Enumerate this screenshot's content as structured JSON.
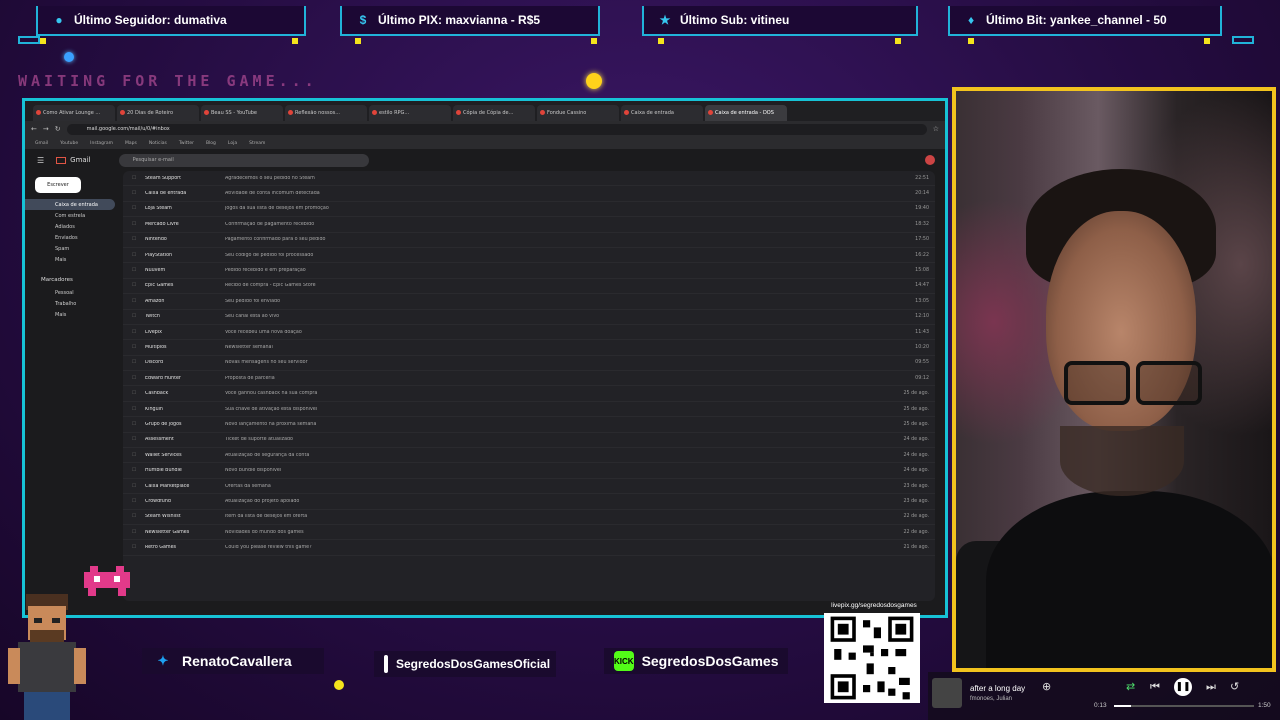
{
  "alerts": {
    "follower": "Último Seguidor: dumativa",
    "pix": "Último PIX: maxvianna - R$5",
    "sub": "Último Sub: vitineu",
    "bit": "Último Bit: yankee_channel - 50"
  },
  "waiting_text": "WAITING FOR THE GAME...",
  "browser": {
    "tabs": [
      "Como Ativar Lounge ...",
      "20 Dias de Roteiro",
      "Beau SS - YouTube",
      "Reflexão nossos...",
      "estilo RPG...",
      "Cópia de Cópia de...",
      "Fondue Cassino",
      "Caixa de entrada",
      "Caixa de entrada - DOS"
    ],
    "address": "mail.google.com/mail/u/0/#inbox",
    "bookmarks": [
      "Gmail",
      "Youtube",
      "Instagram",
      "Maps",
      "Noticias",
      "Twitter",
      "Blog",
      "Loja",
      "Stream"
    ]
  },
  "gmail": {
    "brand": "Gmail",
    "search_placeholder": "Pesquisar e-mail",
    "compose": "Escrever",
    "sidebar": [
      "Caixa de entrada",
      "Com estrela",
      "Adiados",
      "Enviados",
      "Spam",
      "Mais"
    ],
    "labels_title": "Marcadores",
    "labels": [
      "Pessoal",
      "Trabalho",
      "Mais"
    ],
    "rows": [
      {
        "sender": "Steam Support",
        "subject": "Agradecemos o seu pedido no Steam",
        "date": "22:51"
      },
      {
        "sender": "Caixa de entrada",
        "subject": "Atividade de conta incomum detectada",
        "date": "20:14"
      },
      {
        "sender": "Loja Steam",
        "subject": "Jogos da sua lista de desejos em promoção",
        "date": "19:40"
      },
      {
        "sender": "Mercado Livre",
        "subject": "Confirmação de pagamento recebido",
        "date": "18:32"
      },
      {
        "sender": "Nintendo",
        "subject": "Pagamento confirmado para o seu pedido",
        "date": "17:50"
      },
      {
        "sender": "PlayStation",
        "subject": "Seu código de pedido foi processado",
        "date": "16:22"
      },
      {
        "sender": "Nuuvem",
        "subject": "Pedido recebido e em preparação",
        "date": "15:08"
      },
      {
        "sender": "Epic Games",
        "subject": "Recibo de compra - Epic Games Store",
        "date": "14:47"
      },
      {
        "sender": "Amazon",
        "subject": "Seu pedido foi enviado",
        "date": "13:05"
      },
      {
        "sender": "Twitch",
        "subject": "Seu canal está ao vivo",
        "date": "12:10"
      },
      {
        "sender": "Livepix",
        "subject": "Você recebeu uma nova doação",
        "date": "11:43"
      },
      {
        "sender": "Multiplos",
        "subject": "Newsletter semanal",
        "date": "10:20"
      },
      {
        "sender": "Discord",
        "subject": "Novas mensagens no seu servidor",
        "date": "09:55"
      },
      {
        "sender": "Edward Hunter",
        "subject": "Proposta de parceria",
        "date": "09:12"
      },
      {
        "sender": "Cashback",
        "subject": "Você ganhou cashback na sua compra",
        "date": "25 de ago."
      },
      {
        "sender": "Kinguin",
        "subject": "Sua chave de ativação está disponível",
        "date": "25 de ago."
      },
      {
        "sender": "Grupo de jogos",
        "subject": "Novo lançamento na próxima semana",
        "date": "25 de ago."
      },
      {
        "sender": "Assessment",
        "subject": "Ticket de suporte atualizado",
        "date": "24 de ago."
      },
      {
        "sender": "Wallet Services",
        "subject": "Atualização de segurança da conta",
        "date": "24 de ago."
      },
      {
        "sender": "Humble Bundle",
        "subject": "Novo bundle disponível",
        "date": "24 de ago."
      },
      {
        "sender": "Caixa Marketplace",
        "subject": "Ofertas da semana",
        "date": "23 de ago."
      },
      {
        "sender": "Crowdfund",
        "subject": "Atualização do projeto apoiado",
        "date": "23 de ago."
      },
      {
        "sender": "Steam Wishlist",
        "subject": "Item da lista de desejos em oferta",
        "date": "22 de ago."
      },
      {
        "sender": "Newsletter Games",
        "subject": "Novidades do mundo dos games",
        "date": "22 de ago."
      },
      {
        "sender": "Retro Games",
        "subject": "Could you please review this game?",
        "date": "21 de ago."
      }
    ]
  },
  "social": {
    "twitter": "RenatoCavallera",
    "instagram": "SegredosDosGamesOficial",
    "kick_badge": "KICK",
    "kick": "SegredosDosGames"
  },
  "qr_label": "livepix.gg/segredosdosgames",
  "music": {
    "title": "after a long day",
    "artist": "fmonoes, Julian",
    "time_current": "0:13",
    "time_total": "1:50",
    "progress": 0.12
  },
  "colors": {
    "frame": "#17c2d6",
    "cam_border": "#f2c31e",
    "bg": "#2a0f4a"
  }
}
